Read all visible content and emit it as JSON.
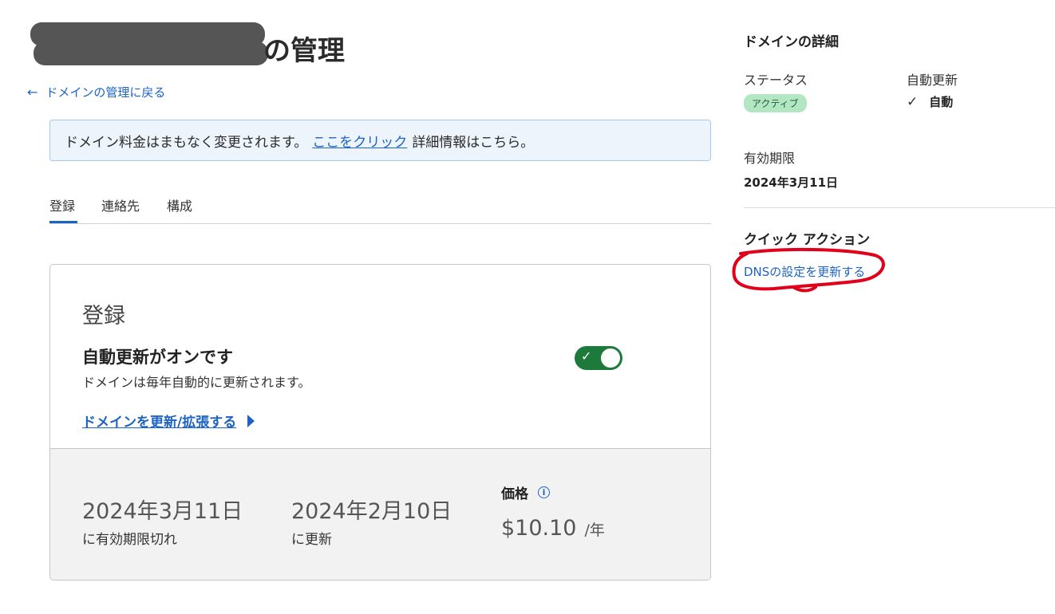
{
  "header": {
    "title_suffix": "の管理",
    "back_link": "ドメインの管理に戻る"
  },
  "notice": {
    "text_before": "ドメイン料金はまもなく変更されます。",
    "link_label": "ここをクリック",
    "text_after": "詳細情報はこちら。"
  },
  "tabs": [
    {
      "label": "登録",
      "active": true
    },
    {
      "label": "連絡先",
      "active": false
    },
    {
      "label": "構成",
      "active": false
    }
  ],
  "registration": {
    "heading": "登録",
    "auto_renew_title": "自動更新がオンです",
    "auto_renew_desc": "ドメインは毎年自動的に更新されます。",
    "auto_renew_enabled": true,
    "renew_link": "ドメインを更新/拡張する",
    "expiry_date": "2024年3月11日",
    "expiry_label": "に有効期限切れ",
    "renew_date": "2024年2月10日",
    "renew_label": "に更新",
    "price_label": "価格",
    "price_value": "$10.10",
    "price_unit": "/年"
  },
  "sidebar": {
    "heading": "ドメインの詳細",
    "status_label": "ステータス",
    "status_value": "アクティブ",
    "auto_renew_label": "自動更新",
    "auto_renew_value": "自動",
    "expiry_label": "有効期限",
    "expiry_value": "2024年3月11日",
    "quick_actions_heading": "クイック アクション",
    "dns_link": "DNSの設定を更新する"
  },
  "colors": {
    "link": "#1d63c6",
    "toggle_on": "#1d7a3a",
    "badge_bg": "#b3e6c2",
    "annotation": "#e0001b"
  }
}
